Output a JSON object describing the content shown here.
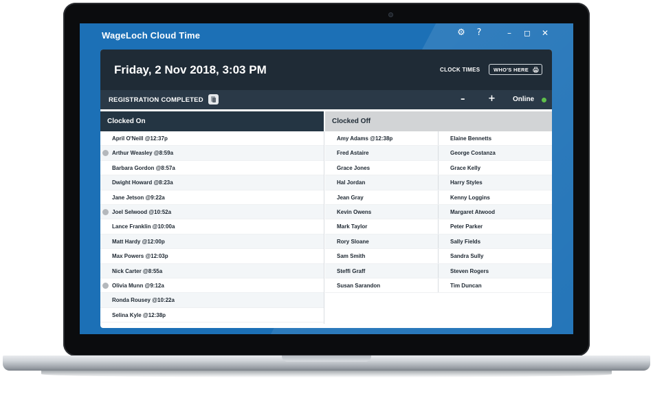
{
  "app": {
    "title": "WageLoch Cloud Time"
  },
  "window_controls": {
    "settings_icon": "gear-icon",
    "help_icon": "question-icon",
    "minimize_icon": "minimize-icon",
    "maximize_icon": "maximize-icon",
    "close_icon": "close-icon",
    "glyphs": {
      "settings": "⚙",
      "help": "?",
      "minimize": "–",
      "maximize": "◻",
      "close": "✕"
    }
  },
  "header": {
    "datetime": "Friday, 2 Nov 2018, 3:03 PM",
    "clock_times_label": "CLOCK TIMES",
    "whos_here_label": "WHO'S HERE"
  },
  "status": {
    "message": "REGISTRATION COMPLETED",
    "minus_label": "–",
    "plus_label": "+",
    "connection": "Online",
    "connection_color": "#5fbf4a"
  },
  "clocked_on": {
    "title": "Clocked On",
    "rows": [
      {
        "name": "April O'Neill @12:37p",
        "icon": false
      },
      {
        "name": "Arthur Weasley @8:59a",
        "icon": true
      },
      {
        "name": "Barbara Gordon @8:57a",
        "icon": false
      },
      {
        "name": "Dwight Howard @8:23a",
        "icon": false
      },
      {
        "name": "Jane Jetson @9:22a",
        "icon": false
      },
      {
        "name": "Joel Selwood @10:52a",
        "icon": true
      },
      {
        "name": "Lance Franklin @10:00a",
        "icon": false
      },
      {
        "name": "Matt Hardy @12:00p",
        "icon": false
      },
      {
        "name": "Max Powers @12:03p",
        "icon": false
      },
      {
        "name": "Nick Carter @8:55a",
        "icon": false
      },
      {
        "name": "Olivia Munn @9:12a",
        "icon": true
      },
      {
        "name": "Ronda Rousey @10:22a",
        "icon": false
      },
      {
        "name": "Selina Kyle @12:38p",
        "icon": false
      }
    ]
  },
  "clocked_off": {
    "title": "Clocked Off",
    "left": [
      "Amy Adams @12:38p",
      "Fred Astaire",
      "Grace Jones",
      "Hal Jordan",
      "Jean Gray",
      "Kevin Owens",
      "Mark Taylor",
      "Rory Sloane",
      "Sam Smith",
      "Steffi Graff",
      "Susan Sarandon"
    ],
    "right": [
      "Elaine Bennetts",
      "George Costanza",
      "Grace Kelly",
      "Harry Styles",
      "Kenny Loggins",
      "Margaret Atwood",
      "Peter Parker",
      "Sally Fields",
      "Sandra Sully",
      "Steven Rogers",
      "Tim Duncan"
    ]
  },
  "colors": {
    "desktop_blue": "#1c70b6",
    "header_dark": "#1f2b36",
    "status_bar": "#2a3947"
  }
}
